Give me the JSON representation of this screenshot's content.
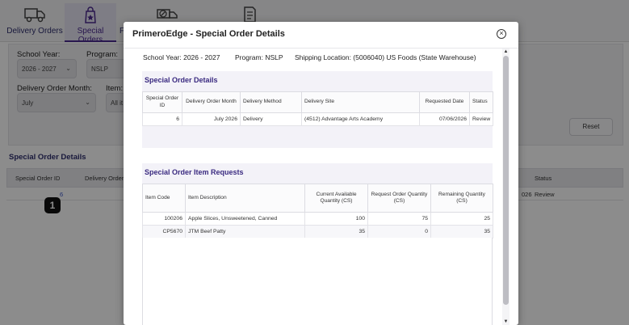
{
  "nav": {
    "tabs": [
      {
        "label": "Delivery Orders",
        "icon": "delivery-truck-icon"
      },
      {
        "label": "Special Orders",
        "icon": "special-order-bag-icon"
      },
      {
        "label": "",
        "icon": "truck-cancel-icon"
      },
      {
        "label": "",
        "icon": "document-list-icon"
      }
    ],
    "partial_label": "F"
  },
  "filters": {
    "school_year_label": "School Year:",
    "school_year_value": "2026 - 2027",
    "program_label": "Program:",
    "program_value": "NSLP",
    "delivery_month_label": "Delivery Order Month:",
    "delivery_month_value": "July",
    "item_label": "Item:",
    "item_value": "All it",
    "reset_label": "Reset"
  },
  "background_grid": {
    "title": "Special Order Details",
    "headers": [
      "Special Order ID",
      "Delivery Order",
      "Status"
    ],
    "row": {
      "id": "6",
      "date_fragment": "026",
      "status": "Review"
    },
    "step_badge": "1"
  },
  "modal": {
    "title": "PrimeroEdge - Special Order Details",
    "close_symbol": "×",
    "info": {
      "school_year": "School Year: 2026 - 2027",
      "program": "Program: NSLP",
      "shipping": "Shipping Location: (5006040) US Foods (State Warehouse)"
    },
    "details": {
      "title": "Special Order Details",
      "headers": [
        "Special Order ID",
        "Delivery Order Month",
        "Delivery Method",
        "Delivery Site",
        "Requested Date",
        "Status"
      ],
      "rows": [
        {
          "id": "6",
          "month": "July 2026",
          "method": "Delivery",
          "site": "(4512) Advantage Arts Academy",
          "date": "07/06/2026",
          "status": "Review"
        }
      ]
    },
    "items": {
      "title": "Special Order Item Requests",
      "headers": [
        "Item Code",
        "Item Description",
        "Current Available Quantity (CS)",
        "Request Order Quantity (CS)",
        "Remaining Quantity (CS)"
      ],
      "rows": [
        {
          "code": "100206",
          "desc": "Apple Slices, Unsweetened, Canned",
          "avail": "100",
          "req": "75",
          "rem": "25"
        },
        {
          "code": "CP5670",
          "desc": "JTM Beef Patty",
          "avail": "35",
          "req": "0",
          "rem": "35"
        }
      ]
    },
    "scroll_up": "▲",
    "scroll_down": "▼"
  },
  "colors": {
    "accent": "#4b2b8f",
    "heading": "#3a2a80",
    "link": "#3a55c9"
  }
}
